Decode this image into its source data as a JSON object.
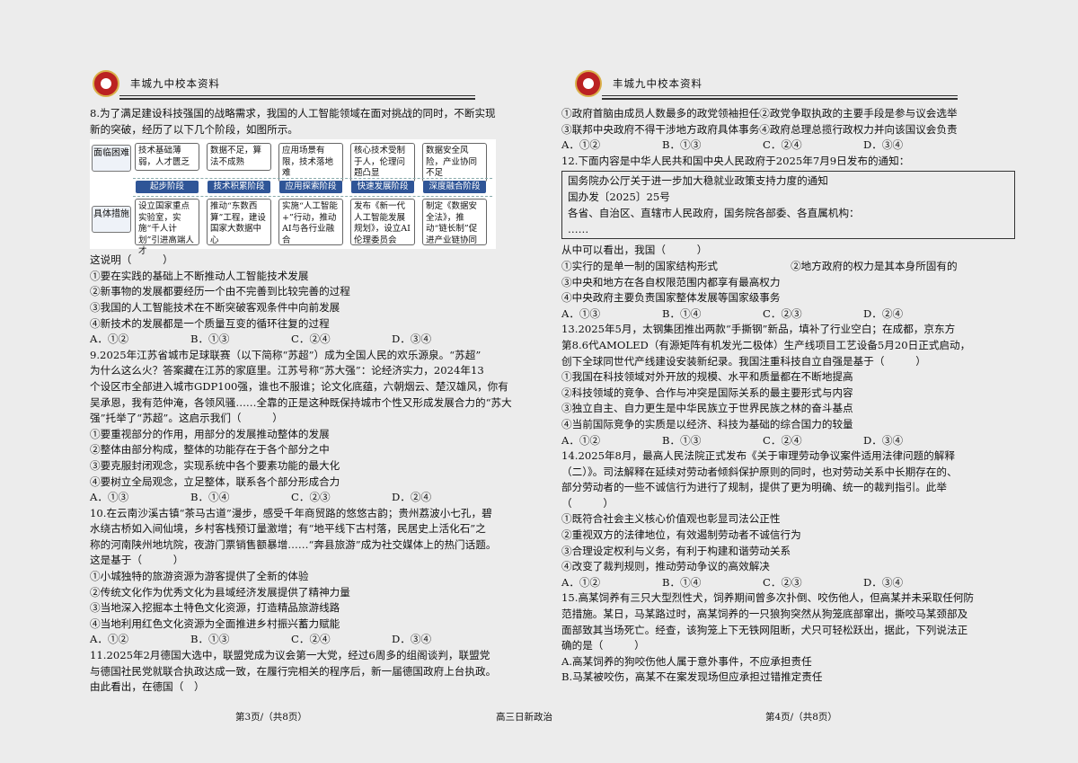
{
  "header": {
    "school": "丰城九中校本资料"
  },
  "left": {
    "q8": {
      "stem": [
        "8.为了满足建设科技强国的战略需求，我国的人工智能领域在面对挑战的同时，不断实现",
        "新的突破，经历了以下几个阶段，如图所示。"
      ],
      "figure": {
        "row1_label": "面临困难",
        "row2_label": "具体措施",
        "difficulties": [
          "技术基础薄弱，人才匮乏",
          "数据不足，算法不成熟",
          "应用场景有限，技术落地难",
          "核心技术受制于人，伦理问题凸显",
          "数据安全风险，产业协同不足"
        ],
        "stages": [
          "起步阶段",
          "技术积累阶段",
          "应用探索阶段",
          "快速发展阶段",
          "深度融合阶段"
        ],
        "measures": [
          "设立国家重点实验室，实施“千人计划”引进高端人才",
          "推动“东数西算”工程，建设国家大数据中心",
          "实施“人工智能+”行动，推动AI与各行业融合",
          "发布《新一代人工智能发展规划》，设立AI伦理委员会",
          "制定《数据安全法》，推动“链长制”促进产业链协同"
        ]
      },
      "lead": "这说明（　　　）",
      "items": [
        "①要在实践的基础上不断推动人工智能技术发展",
        "②新事物的发展都要经历一个由不完善到比较完善的过程",
        "③我国的人工智能技术在不断突破客观条件中向前发展",
        "④新技术的发展都是一个质量互变的循环往复的过程"
      ],
      "options": [
        "A．①②",
        "B．①③",
        "C．②④",
        "D．③④"
      ]
    },
    "q9": {
      "stem": [
        "9.2025年江苏省城市足球联赛（以下简称“苏超”）成为全国人民的欢乐源泉。“苏超”",
        "为什么这么火？答案藏在江苏的家庭里。江苏号称“苏大强”：论经济实力，2024年13",
        "个设区市全部进入城市GDP100强，谁也不服谁；论文化底蕴，六朝烟云、楚汉雄风，你有",
        "吴承恩，我有范仲淹，各领风骚……全靠的正是这种既保持城市个性又形成发展合力的“苏大",
        "强”托举了“苏超”。这启示我们（　　　）"
      ],
      "items": [
        "①要重视部分的作用，用部分的发展推动整体的发展",
        "②整体由部分构成，整体的功能存在于各个部分之中",
        "③要克服封闭观念，实现系统中各个要素功能的最大化",
        "④要树立全局观念，立足整体，联系各个部分形成合力"
      ],
      "options": [
        "A．①③",
        "B．①④",
        "C．②③",
        "D．②④"
      ]
    },
    "q10": {
      "stem": [
        "10.在云南沙溪古镇“茶马古道”漫步，感受千年商贸路的悠悠古韵；贵州荔波小七孔，碧",
        "水绕古桥如入间仙境，乡村客栈预订量激增；有“地平线下古村落，民居史上活化石”之",
        "称的河南陕州地坑院，夜游门票销售额暴增……“奔县旅游”成为社交媒体上的热门话题。",
        "这是基于（　　　）"
      ],
      "items": [
        "①小城独特的旅游资源为游客提供了全新的体验",
        "②传统文化作为优秀文化为县域经济发展提供了精神力量",
        "③当地深入挖掘本土特色文化资源，打造精品旅游线路",
        "④当地利用红色文化资源为全面推进乡村振兴蓄力赋能"
      ],
      "options": [
        "A．①②",
        "B．①③",
        "C．②④",
        "D．③④"
      ]
    },
    "q11": {
      "stem": [
        "11.2025年2月德国大选中，联盟党成为议会第一大党，经过6周多的组阁谈判，联盟党",
        "与德国社民党就联合执政达成一致，在履行完相关的程序后，新一届德国政府上台执政。",
        "由此看出，在德国（　）"
      ]
    },
    "footer": "第3页/（共8页）"
  },
  "right": {
    "q11_cont": {
      "items": [
        "①政府首脑由成员人数最多的政党领袖担任②政党争取执政的主要手段是参与议会选举",
        "③联邦中央政府不得干涉地方政府具体事务④政府总理总揽行政权力并向该国议会负责"
      ],
      "options": [
        "A．①②",
        "B．①③",
        "C．②④",
        "D．③④"
      ]
    },
    "q12": {
      "stem": "12.下面内容是中华人民共和国中央人民政府于2025年7月9日发布的通知：",
      "notice": [
        "国务院办公厅关于进一步加大稳就业政策支持力度的通知",
        "国办发〔2025〕25号",
        "各省、自治区、直辖市人民政府，国务院各部委、各直属机构：",
        "……"
      ],
      "lead": "从中可以看出，我国（　　　）",
      "items": [
        "①实行的是单一制的国家结构形式　　　　　　　②地方政府的权力是其本身所固有的",
        "③中央和地方在各自权限范围内都享有最高权力",
        "④中央政府主要负责国家整体发展等国家级事务"
      ],
      "options": [
        "A．①③",
        "B．①④",
        "C．②③",
        "D．②④"
      ]
    },
    "q13": {
      "stem": [
        "13.2025年5月，太钢集团推出两款“手撕钢”新品，填补了行业空白；在成都，京东方",
        "第8.6代AMOLED（有源矩阵有机发光二极体）生产线项目工艺设备5月20日正式启动，",
        "创下全球同世代产线建设安装新纪录。我国注重科技自立自强是基于（　　　）"
      ],
      "items": [
        "①我国在科技领域对外开放的规模、水平和质量都在不断地提高",
        "②科技领域的竞争、合作与冲突是国际关系的最主要形式与内容",
        "③独立自主、自力更生是中华民族立于世界民族之林的奋斗基点",
        "④当前国际竞争的实质是以经济、科技为基础的综合国力的较量"
      ],
      "options": [
        "A．①②",
        "B．①③",
        "C．②④",
        "D．③④"
      ]
    },
    "q14": {
      "stem": [
        "14.2025年8月，最高人民法院正式发布《关于审理劳动争议案件适用法律问题的解释",
        "（二）》。司法解释在延续对劳动者倾斜保护原则的同时，也对劳动关系中长期存在的、",
        "部分劳动者的一些不诚信行为进行了规制，提供了更为明确、统一的裁判指引。此举",
        "（　　　）"
      ],
      "items": [
        "①既符合社会主义核心价值观也彰显司法公正性",
        "②重视双方的法律地位，有效遏制劳动者不诚信行为",
        "③合理设定权利与义务，有利于构建和谐劳动关系",
        "④改变了裁判规则，推动劳动争议的高效解决"
      ],
      "options": [
        "A．①②",
        "B．①④",
        "C．②③",
        "D．③④"
      ]
    },
    "q15": {
      "stem": [
        "15.高某饲养有三只大型烈性犬，饲养期间曾多次扑倒、咬伤他人，但高某并未采取任何防",
        "范措施。某日，马某路过时，高某饲养的一只狼狗突然从狗笼底部窜出，撕咬马某颈部及",
        "面部致其当场死亡。经查，该狗笼上下无铁网阻断，犬只可轻松跃出，据此，下列说法正",
        "确的是（　　　）"
      ],
      "choices": [
        "A.高某饲养的狗咬伤他人属于意外事件，不应承担责任",
        "B.马某被咬伤，高某不在案发现场但应承担过错推定责任"
      ]
    },
    "footer": "第4页/（共8页）"
  },
  "center_footer": "高三日新政治"
}
